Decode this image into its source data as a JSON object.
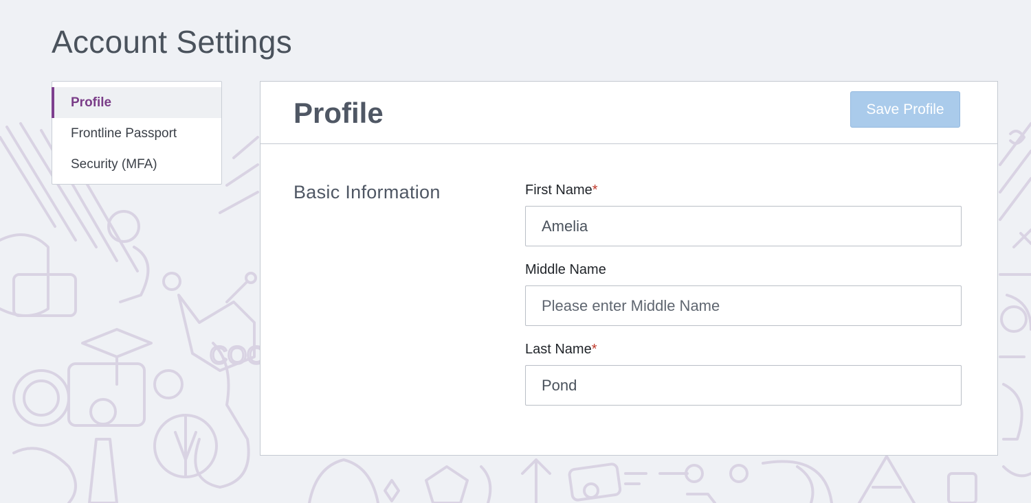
{
  "page": {
    "title": "Account Settings"
  },
  "sidebar": {
    "items": [
      {
        "label": "Profile",
        "active": true
      },
      {
        "label": "Frontline Passport",
        "active": false
      },
      {
        "label": "Security (MFA)",
        "active": false
      }
    ]
  },
  "card": {
    "title": "Profile",
    "save_label": "Save Profile",
    "section_label": "Basic Information"
  },
  "form": {
    "first_name": {
      "label": "First Name",
      "required_mark": "*",
      "value": "Amelia",
      "placeholder": ""
    },
    "middle_name": {
      "label": "Middle Name",
      "value": "",
      "placeholder": "Please enter Middle Name"
    },
    "last_name": {
      "label": "Last Name",
      "required_mark": "*",
      "value": "Pond",
      "placeholder": ""
    }
  },
  "colors": {
    "accent": "#7e3f8e",
    "save_button_disabled": "#aacbeb",
    "required": "#c0392b",
    "background": "#eff1f5"
  }
}
